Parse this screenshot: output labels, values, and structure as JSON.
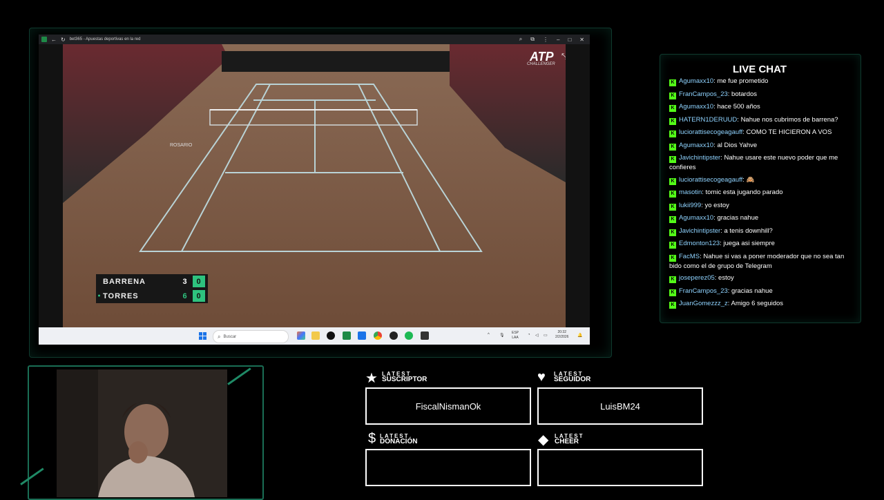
{
  "browser": {
    "tab_title": "bet365 - Apuestas deportivas en la red",
    "controls": {
      "zoom_icon": "search-icon",
      "extensions_icon": "extension-icon",
      "menu_icon": "kebab-icon",
      "minimize": "–",
      "maximize": "□",
      "close": "✕"
    }
  },
  "stream": {
    "overlay_logo": "ATP",
    "overlay_logo_sub": "CHALLENGER",
    "venue_text": "ROSARIO",
    "scoreboard": [
      {
        "name": "BARRENA",
        "games": "3",
        "points": "0",
        "serving": false
      },
      {
        "name": "TORRES",
        "games": "6",
        "points": "0",
        "serving": true
      }
    ]
  },
  "taskbar": {
    "search_placeholder": "Buscar",
    "lang_line1": "ESP",
    "lang_line2": "LAA",
    "time": "20:32",
    "date": "2/2/2026"
  },
  "chat": {
    "title": "LIVE CHAT",
    "messages": [
      {
        "user": "Agumaxx10",
        "text": "me fue prometido"
      },
      {
        "user": "FranCampos_23",
        "text": "botardos"
      },
      {
        "user": "Agumaxx10",
        "text": "hace 500 años"
      },
      {
        "user": "HATERN1DERUUD",
        "text": "Nahue nos cubrimos de barrena?"
      },
      {
        "user": "luciorattisecogeagauff",
        "text": "COMO TE HICIERON A VOS"
      },
      {
        "user": "Agumaxx10",
        "text": "al Dios Yahve"
      },
      {
        "user": "Javichintipster",
        "text": "Nahue usare este nuevo poder que me confieres"
      },
      {
        "user": "luciorattisecogeagauff",
        "text": "🙈"
      },
      {
        "user": "masotin",
        "text": "tomic esta jugando parado"
      },
      {
        "user": "lukii999",
        "text": "yo estoy"
      },
      {
        "user": "Agumaxx10",
        "text": "gracias nahue"
      },
      {
        "user": "Javichintipster",
        "text": "a tenis downhill?"
      },
      {
        "user": "Edmonton123",
        "text": "juega asi siempre"
      },
      {
        "user": "FacMS",
        "text": "Nahue si vas a poner moderador que no sea tan bido como el de grupo de Telegram"
      },
      {
        "user": "joseperez05",
        "text": "estoy"
      },
      {
        "user": "FranCampos_23",
        "text": "gracias nahue"
      },
      {
        "user": "JuanGomezzz_z",
        "text": "Amigo 6 seguidos"
      }
    ]
  },
  "alerts": {
    "suscriptor": {
      "small": "LATEST",
      "big": "SUSCRIPTOR",
      "value": "FiscalNismanOk"
    },
    "seguidor": {
      "small": "LATEST",
      "big": "SEGUIDOR",
      "value": "LuisBM24"
    },
    "donacion": {
      "small": "LATEST",
      "big": "DONACIÓN",
      "value": ""
    },
    "cheer": {
      "small": "LATEST",
      "big": "CHEER",
      "value": ""
    }
  }
}
